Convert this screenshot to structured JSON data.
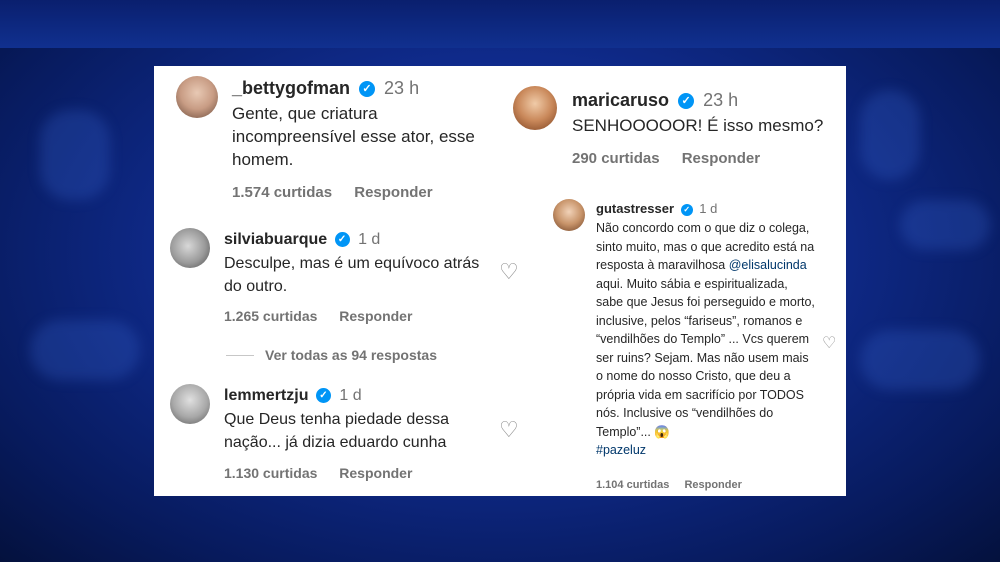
{
  "comments": {
    "betty": {
      "username": "_bettygofman",
      "time": "23 h",
      "text": "Gente, que criatura incompreensível esse ator, esse homem.",
      "likes": "1.574 curtidas",
      "reply": "Responder"
    },
    "silvia": {
      "username": "silviabuarque",
      "time": "1 d",
      "text": "Desculpe, mas é um equívoco atrás do outro.",
      "likes": "1.265 curtidas",
      "reply": "Responder",
      "view_replies": "Ver todas as 94 respostas"
    },
    "lemmertz": {
      "username": "lemmertzju",
      "time": "1 d",
      "text": "Que Deus tenha piedade dessa nação... já dizia eduardo cunha",
      "likes": "1.130 curtidas",
      "reply": "Responder"
    },
    "mari": {
      "username": "maricaruso",
      "time": "23 h",
      "text": "SENHOOOOOR! É isso mesmo?",
      "likes": "290 curtidas",
      "reply": "Responder"
    },
    "guta": {
      "username": "gutastresser",
      "time": "1 d",
      "text_before": "Não concordo com o que diz o colega, sinto muito, mas o que acredito está na resposta à maravilhosa ",
      "mention": "@elisalucinda",
      "text_after": " aqui. Muito sábia e espiritualizada, sabe que Jesus foi perseguido e morto, inclusive, pelos “fariseus”, romanos e “vendilhões do Templo” ... Vcs querem ser ruins? Sejam. Mas não usem mais o nome do nosso Cristo, que deu a própria vida em sacrifício por TODOS nós. Inclusive os “vendilhões do Templo”... ",
      "emoji": "😱",
      "hashtag": "#pazeluz",
      "likes": "1.104 curtidas",
      "reply": "Responder"
    }
  },
  "icons": {
    "verified": "✓",
    "heart": "♡"
  },
  "colors": {
    "verified_badge": "#0095f6",
    "background_blue": "#0f2a8a"
  }
}
